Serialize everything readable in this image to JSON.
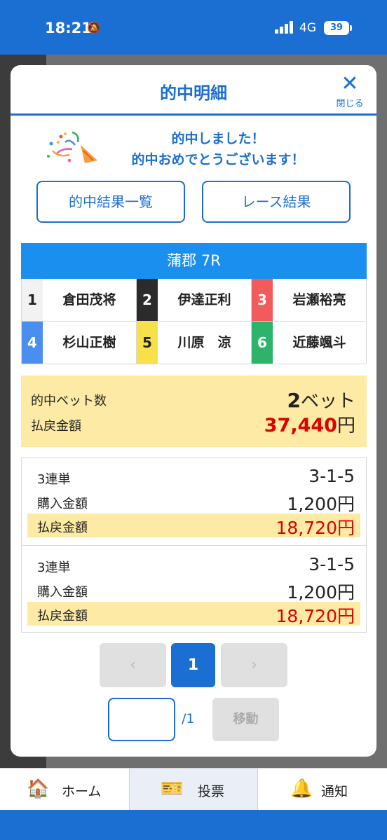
{
  "status_bar": {
    "time": "18:21",
    "network": "4G",
    "battery": "39"
  },
  "modal": {
    "title": "的中明細",
    "close_label": "閉じる",
    "congrats_line1": "的中しました！",
    "congrats_line2": "的中おめでとうございます！",
    "btn_results": "的中結果一覧",
    "btn_race": "レース結果"
  },
  "race": {
    "header": "蒲郡 7R",
    "runners": [
      {
        "num": "1",
        "name": "倉田茂将",
        "bg": "#f2f2f2",
        "fg": "#222222"
      },
      {
        "num": "2",
        "name": "伊達正利",
        "bg": "#2b2b2b",
        "fg": "#ffffff"
      },
      {
        "num": "3",
        "name": "岩瀬裕亮",
        "bg": "#f25b5b",
        "fg": "#ffffff"
      },
      {
        "num": "4",
        "name": "杉山正樹",
        "bg": "#4a8ef0",
        "fg": "#ffffff"
      },
      {
        "num": "5",
        "name": "川原　涼",
        "bg": "#f8e04a",
        "fg": "#222222"
      },
      {
        "num": "6",
        "name": "近藤颯斗",
        "bg": "#2db36a",
        "fg": "#ffffff"
      }
    ]
  },
  "summary": {
    "hit_label": "的中ベット数",
    "hit_value": "2",
    "hit_unit": "ベット",
    "payout_label": "払戻金額",
    "payout_value": "37,440",
    "payout_unit": "円"
  },
  "tickets": [
    {
      "type": "3連単",
      "combo": "3-1-5",
      "purchase_label": "購入金額",
      "purchase": "1,200円",
      "payout_label": "払戻金額",
      "payout": "18,720円"
    },
    {
      "type": "3連単",
      "combo": "3-1-5",
      "purchase_label": "購入金額",
      "purchase": "1,200円",
      "payout_label": "払戻金額",
      "payout": "18,720円"
    }
  ],
  "pager": {
    "prev": "‹",
    "current": "1",
    "next": "›",
    "input_value": "",
    "total": "/1",
    "move_label": "移動"
  },
  "bottom_nav": {
    "home": "ホーム",
    "bet": "投票",
    "notice": "通知"
  },
  "colors": {
    "primary": "#1b6fd3",
    "race_header": "#1b8ff0",
    "highlight": "#fdeaa4",
    "payout_red": "#e00000"
  }
}
